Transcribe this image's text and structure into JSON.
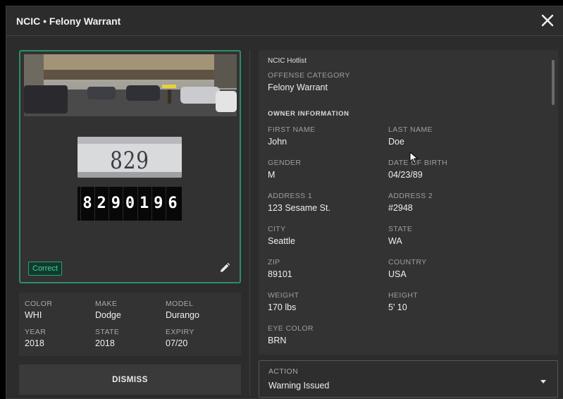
{
  "header": {
    "title": "NCIC • Felony Warrant"
  },
  "plate": {
    "photo_text": "829 0196",
    "read_chars": [
      "8",
      "2",
      "9",
      "0",
      "1",
      "9",
      "6"
    ]
  },
  "photo_card": {
    "badge": "Correct",
    "border_color": "#2f8c6a"
  },
  "vehicle": {
    "fields": [
      {
        "label": "COLOR",
        "value": "WHI"
      },
      {
        "label": "MAKE",
        "value": "Dodge"
      },
      {
        "label": "MODEL",
        "value": "Durango"
      },
      {
        "label": "YEAR",
        "value": "2018"
      },
      {
        "label": "STATE",
        "value": "2018"
      },
      {
        "label": "EXPIRY",
        "value": "07/20"
      }
    ]
  },
  "dismiss_label": "DISMISS",
  "info": {
    "hotlist": "NCIC Hotlist",
    "offense_label": "OFFENSE CATEGORY",
    "offense_value": "Felony Warrant",
    "section_title": "OWNER INFORMATION",
    "fields": [
      {
        "label": "FIRST NAME",
        "value": "John"
      },
      {
        "label": "LAST NAME",
        "value": "Doe"
      },
      {
        "label": "GENDER",
        "value": "M"
      },
      {
        "label": "DATE OF BIRTH",
        "value": "04/23/89"
      },
      {
        "label": "ADDRESS 1",
        "value": "123 Sesame St."
      },
      {
        "label": "ADDRESS 2",
        "value": "#2948"
      },
      {
        "label": "CITY",
        "value": "Seattle"
      },
      {
        "label": "STATE",
        "value": "WA"
      },
      {
        "label": "ZIP",
        "value": "89101"
      },
      {
        "label": "COUNTRY",
        "value": "USA"
      },
      {
        "label": "WEIGHT",
        "value": "170 lbs"
      },
      {
        "label": "HEIGHT",
        "value": "5' 10"
      },
      {
        "label": "EYE COLOR",
        "value": "BRN"
      }
    ]
  },
  "action": {
    "label": "ACTION",
    "value": "Warning Issued"
  },
  "icons": {
    "close": "close-icon",
    "edit": "pencil-icon",
    "dropdown": "caret-down-icon"
  },
  "colors": {
    "accent": "#2f8c6a",
    "badge_text": "#3fd29a"
  }
}
